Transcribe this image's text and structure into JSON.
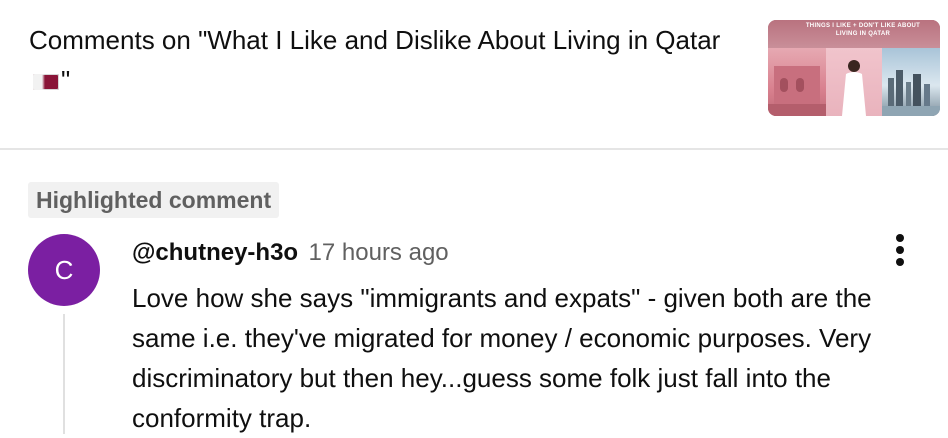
{
  "header": {
    "title_prefix": "Comments on \"What I Like and Dislike About Living in Qatar",
    "title_suffix": "\"",
    "flag_icon": "qatar-flag-emoji",
    "thumbnail_text": "THINGS I LIKE + DON'T LIKE ABOUT LIVING IN QATAR"
  },
  "highlight": {
    "label": "Highlighted comment"
  },
  "comment": {
    "avatar_letter": "C",
    "avatar_color": "#7b1fa2",
    "author": "@chutney-h3o",
    "time": "17 hours ago",
    "text": "Love how she says \"immigrants and expats\" - given both are the same i.e. they've migrated for money / economic purposes. Very discriminatory but then hey...guess some folk just fall into the conformity trap.",
    "menu_icon": "more-vert-icon"
  }
}
